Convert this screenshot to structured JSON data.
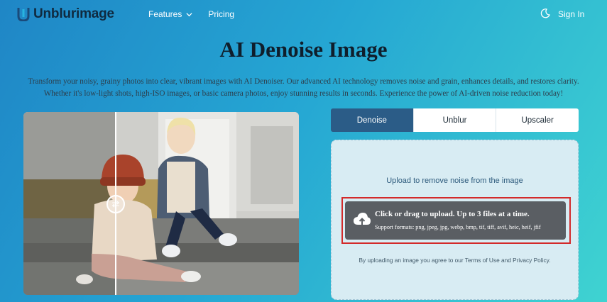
{
  "nav": {
    "logo_text": "Unblurimage",
    "links": [
      {
        "label": "Features",
        "icon": "chevron-down-icon"
      },
      {
        "label": "Pricing"
      }
    ],
    "theme_icon": "moon-icon",
    "sign_in": "Sign In"
  },
  "hero": {
    "title": "AI Denoise Image",
    "description": "Transform your noisy, grainy photos into clear, vibrant images with AI Denoiser. Our advanced AI technology removes noise and grain, enhances details, and restores clarity. Whether it's low-light shots, high-ISO images, or basic camera photos, enjoy stunning results in seconds. Experience the power of AI-driven noise reduction today!"
  },
  "compare": {
    "handle_icon": "swap-arrows-icon"
  },
  "tabs": [
    {
      "label": "Denoise",
      "active": true
    },
    {
      "label": "Unblur",
      "active": false
    },
    {
      "label": "Upscaler",
      "active": false
    }
  ],
  "upload": {
    "title": "Upload to remove noise from the image",
    "button_main": "Click or drag to upload. Up to 3 files at a time.",
    "button_sub": "Support formats: png, jpeg, jpg, webp, bmp, tif, tiff, avif, heic, heif, jfif",
    "upload_icon": "cloud-upload-icon",
    "terms": "By uploading an image you agree to our Terms of Use and Privacy Policy."
  },
  "colors": {
    "accent_tab": "#2b5c87",
    "highlight": "#d32a2a",
    "drop_button": "#5a5e63"
  }
}
